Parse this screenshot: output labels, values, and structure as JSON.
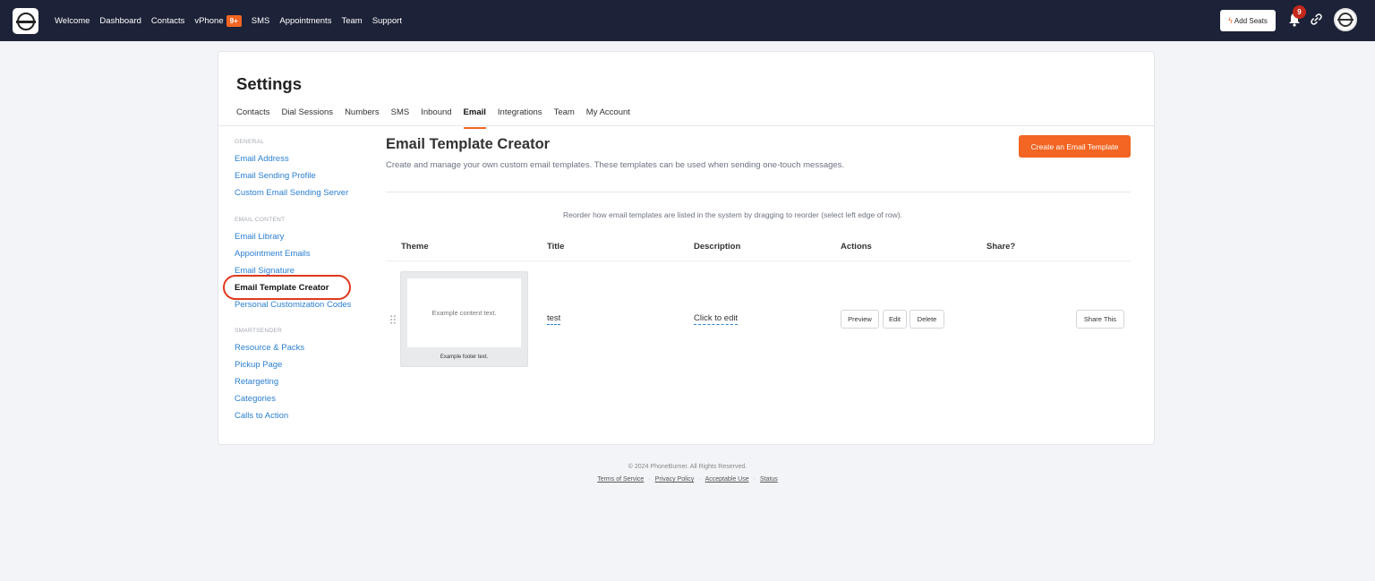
{
  "topnav": {
    "links": [
      "Welcome",
      "Dashboard",
      "Contacts",
      "vPhone",
      "SMS",
      "Appointments",
      "Team",
      "Support"
    ],
    "vphone_badge": "9+",
    "add_seats": "Add Seats",
    "notification_count": "9"
  },
  "settings": {
    "title": "Settings",
    "tabs": [
      "Contacts",
      "Dial Sessions",
      "Numbers",
      "SMS",
      "Inbound",
      "Email",
      "Integrations",
      "Team",
      "My Account"
    ],
    "active_tab": "Email"
  },
  "sidebar": {
    "general_heading": "GENERAL",
    "general": [
      "Email Address",
      "Email Sending Profile",
      "Custom Email Sending Server"
    ],
    "email_content_heading": "EMAIL CONTENT",
    "email_content": [
      "Email Library",
      "Appointment Emails",
      "Email Signature",
      "Email Template Creator",
      "Personal Customization Codes"
    ],
    "smartsender_heading": "SMARTSENDER",
    "smartsender": [
      "Resource & Packs",
      "Pickup Page",
      "Retargeting",
      "Categories",
      "Calls to Action"
    ]
  },
  "main": {
    "title": "Email Template Creator",
    "subtitle": "Create and manage your own custom email templates. These templates can be used when sending one-touch messages.",
    "create_button": "Create an Email Template",
    "reorder_note": "Reorder how email templates are listed in the system by dragging to reorder (select left edge of row).",
    "columns": [
      "Theme",
      "Title",
      "Description",
      "Actions",
      "Share?"
    ],
    "row": {
      "theme_content": "Example content text.",
      "theme_footer": "Example footer text.",
      "title": "test",
      "description": "Click to edit",
      "actions": [
        "Preview",
        "Edit",
        "Delete"
      ],
      "share": "Share This"
    }
  },
  "footer": {
    "copyright": "© 2024 PhoneBurner. All Rights Reserved.",
    "links": [
      "Terms of Service",
      "Privacy Policy",
      "Acceptable Use",
      "Status"
    ]
  },
  "colors": {
    "nav_bg": "#1c2237",
    "accent": "#f26522",
    "link": "#2b7fd2",
    "notification": "#c4281c",
    "highlight_circle": "#e0381e"
  }
}
